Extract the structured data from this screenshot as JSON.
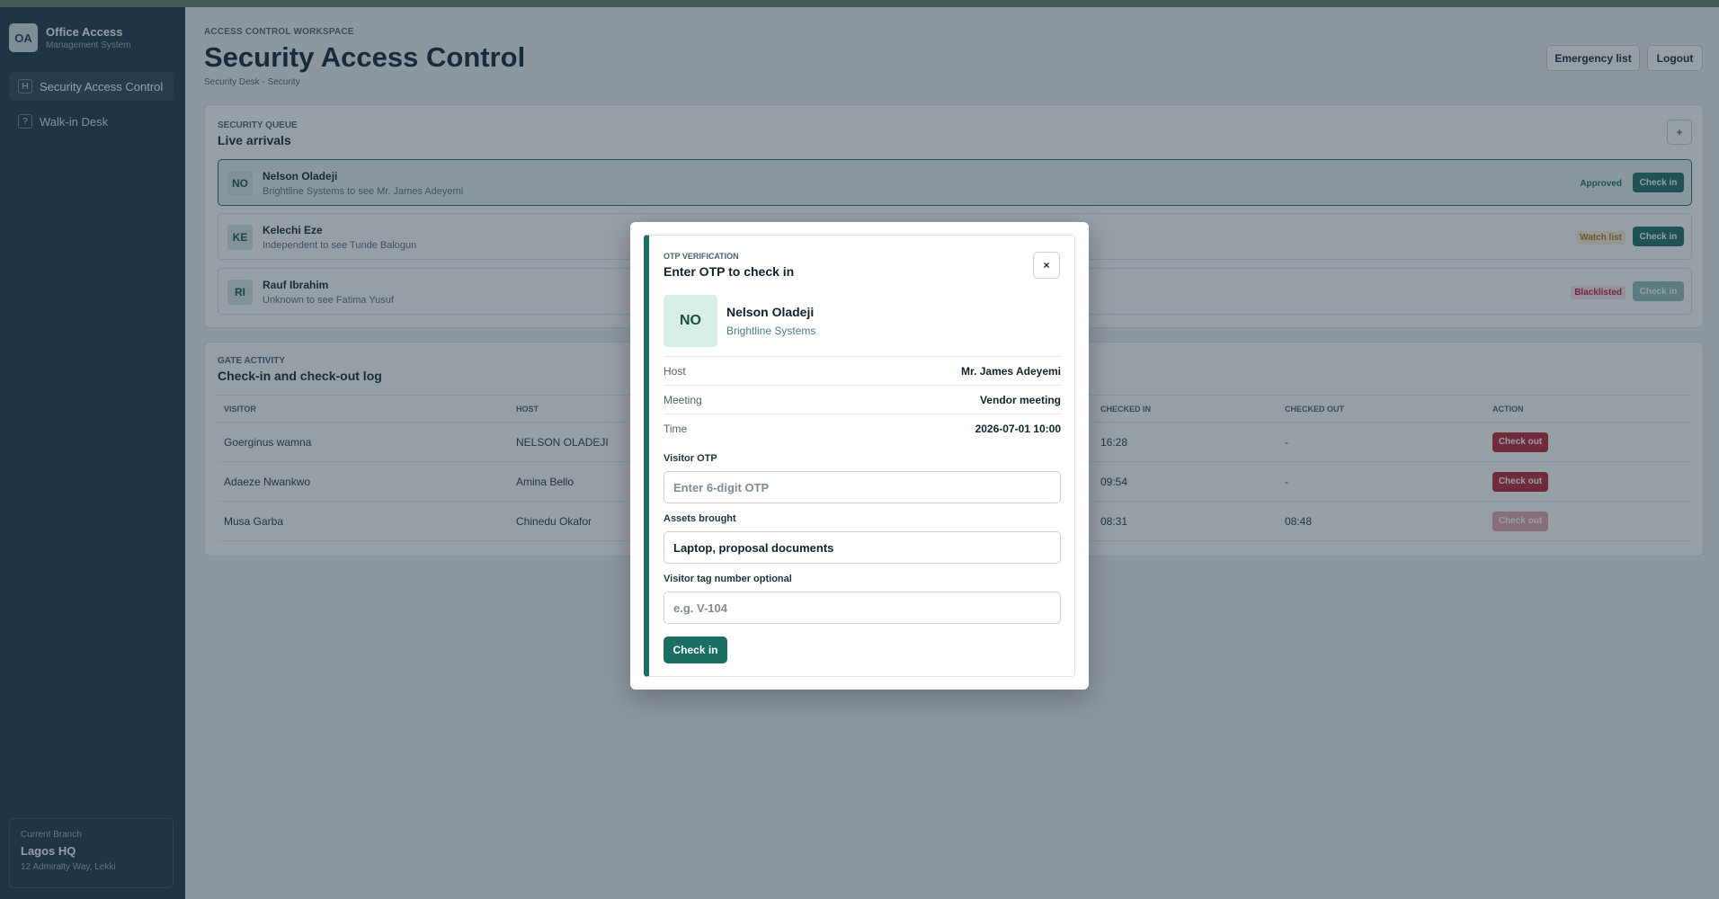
{
  "sidebar": {
    "logo": "OA",
    "title": "Office Access",
    "subtitle": "Management System",
    "items": [
      {
        "icon": "H",
        "label": "Security Access Control",
        "active": true
      },
      {
        "icon": "?",
        "label": "Walk-in Desk",
        "active": false
      }
    ],
    "branch": {
      "label": "Current Branch",
      "name": "Lagos HQ",
      "address": "12 Admiralty Way, Lekki"
    }
  },
  "header": {
    "eyebrow": "ACCESS CONTROL WORKSPACE",
    "title": "Security Access Control",
    "subtitle": "Security Desk - Security",
    "emergency_label": "Emergency list",
    "logout_label": "Logout"
  },
  "queue": {
    "eyebrow": "SECURITY QUEUE",
    "title": "Live arrivals",
    "add_label": "+",
    "arrivals": [
      {
        "initials": "NO",
        "name": "Nelson Oladeji",
        "detail": "Brightline Systems to see Mr. James Adeyemi",
        "status": "Approved",
        "action": "Check in"
      },
      {
        "initials": "KE",
        "name": "Kelechi Eze",
        "detail": "Independent to see Tunde Balogun",
        "status": "Watch list",
        "action": "Check in"
      },
      {
        "initials": "RI",
        "name": "Rauf Ibrahim",
        "detail": "Unknown to see Fatima Yusuf",
        "status": "Blacklisted",
        "action": "Check in"
      }
    ]
  },
  "log": {
    "eyebrow": "GATE ACTIVITY",
    "title": "Check-in and check-out log",
    "columns": [
      "VISITOR",
      "HOST",
      "CHECKED IN",
      "CHECKED OUT",
      "ACTION"
    ],
    "rows": [
      {
        "visitor": "Goerginus wamna",
        "host": "NELSON OLADEJI",
        "checked_in": "16:28",
        "checked_out": "-",
        "action": "Check out"
      },
      {
        "visitor": "Adaeze Nwankwo",
        "host": "Amina Bello",
        "checked_in": "09:54",
        "checked_out": "-",
        "action": "Check out"
      },
      {
        "visitor": "Musa Garba",
        "host": "Chinedu Okafor",
        "checked_in": "08:31",
        "checked_out": "08:48",
        "action": "Check out"
      }
    ]
  },
  "modal": {
    "eyebrow": "OTP VERIFICATION",
    "title": "Enter OTP to check in",
    "close_label": "×",
    "initials": "NO",
    "name": "Nelson Oladeji",
    "company": "Brightline Systems",
    "host_label": "Host",
    "host_value": "Mr. James Adeyemi",
    "meeting_label": "Meeting",
    "meeting_value": "Vendor meeting",
    "time_label": "Time",
    "time_value": "2026-07-01 10:00",
    "otp_label": "Visitor OTP",
    "otp_placeholder": "Enter 6-digit OTP",
    "otp_value": "",
    "assets_label": "Assets brought",
    "assets_value": "Laptop, proposal documents",
    "tag_label": "Visitor tag number optional",
    "tag_placeholder": "e.g. V-104",
    "tag_value": "",
    "submit_label": "Check in"
  },
  "colors": {
    "sidebar_bg": "#1b3447",
    "accent": "#1a6e62",
    "danger": "#b42335",
    "warning": "#b7791f"
  }
}
